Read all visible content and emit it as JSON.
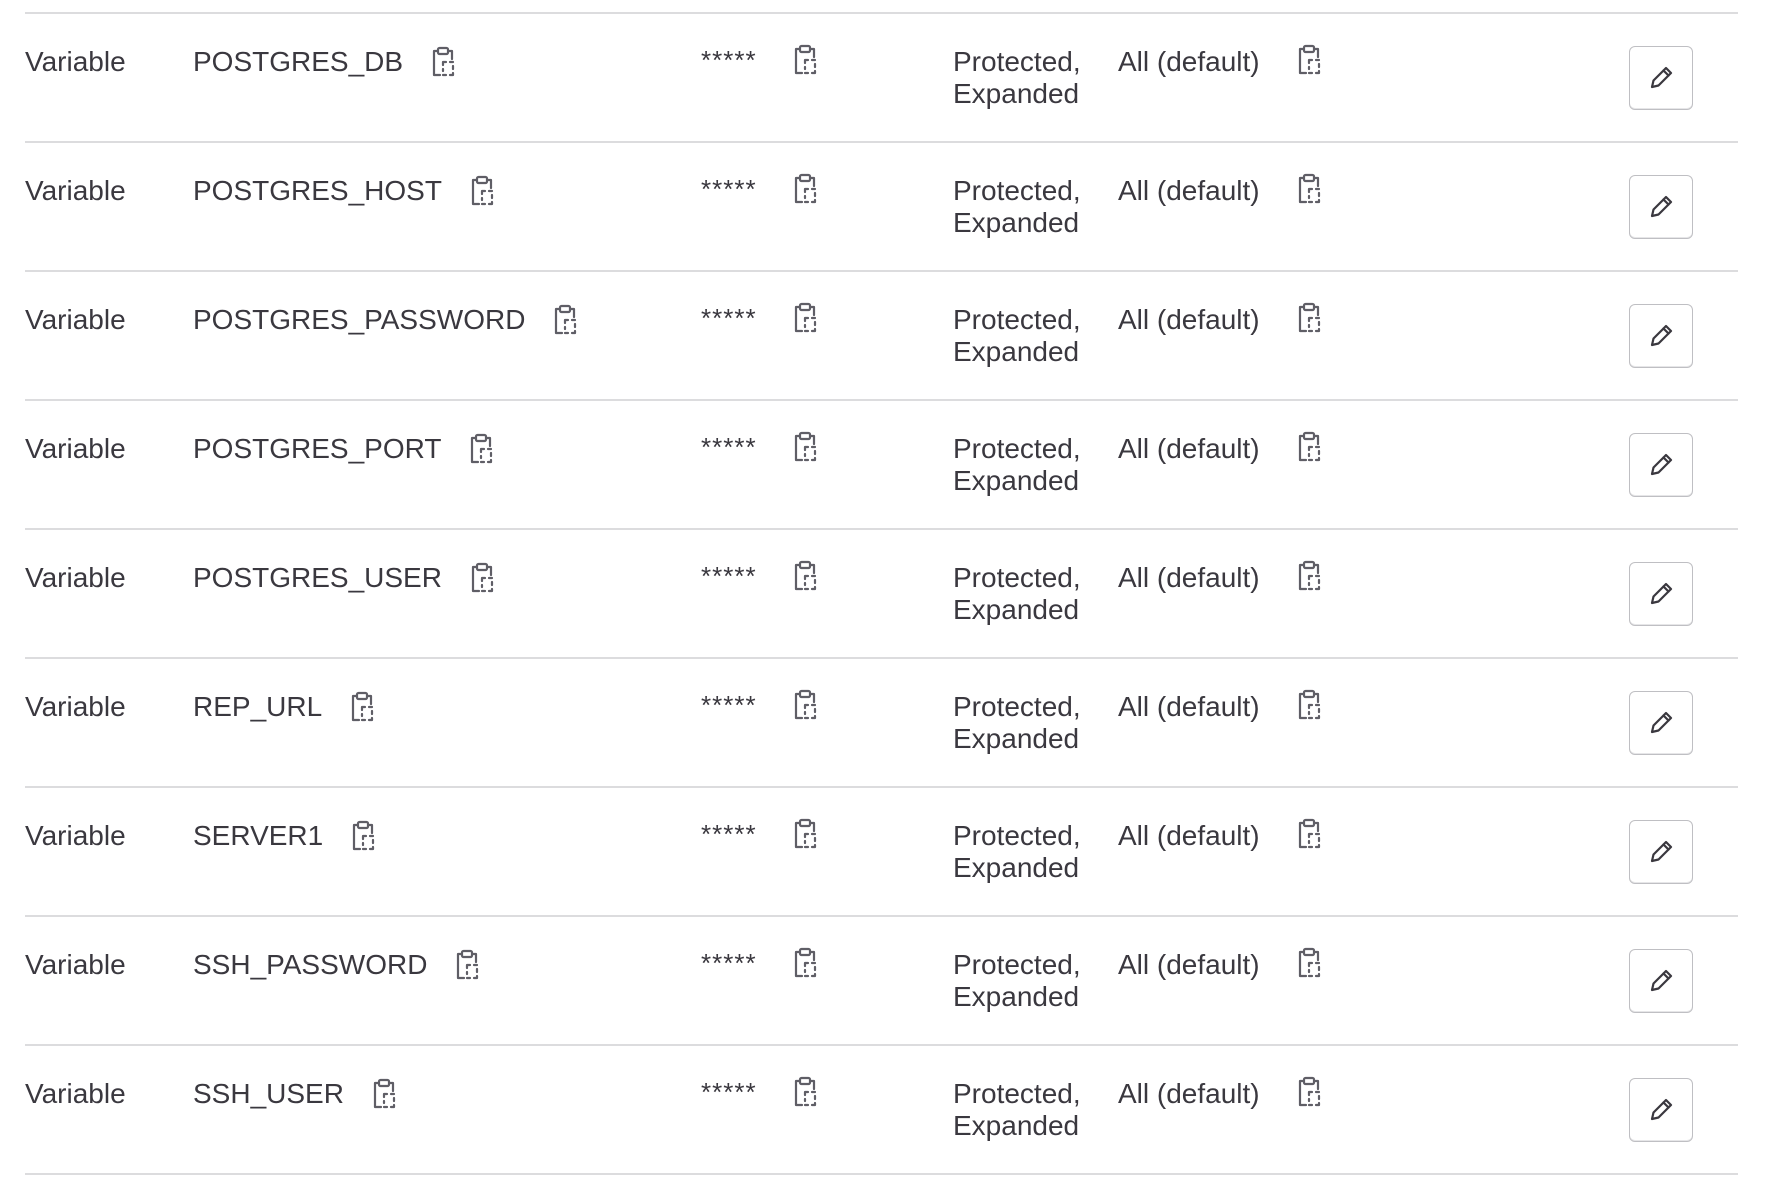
{
  "variables": [
    {
      "type": "Variable",
      "key": "POSTGRES_DB",
      "value": "*****",
      "attributes": [
        "Protected,",
        "Expanded"
      ],
      "environments": "All (default)"
    },
    {
      "type": "Variable",
      "key": "POSTGRES_HOST",
      "value": "*****",
      "attributes": [
        "Protected,",
        "Expanded"
      ],
      "environments": "All (default)"
    },
    {
      "type": "Variable",
      "key": "POSTGRES_PASSWORD",
      "value": "*****",
      "attributes": [
        "Protected,",
        "Expanded"
      ],
      "environments": "All (default)"
    },
    {
      "type": "Variable",
      "key": "POSTGRES_PORT",
      "value": "*****",
      "attributes": [
        "Protected,",
        "Expanded"
      ],
      "environments": "All (default)"
    },
    {
      "type": "Variable",
      "key": "POSTGRES_USER",
      "value": "*****",
      "attributes": [
        "Protected,",
        "Expanded"
      ],
      "environments": "All (default)"
    },
    {
      "type": "Variable",
      "key": "REP_URL",
      "value": "*****",
      "attributes": [
        "Protected,",
        "Expanded"
      ],
      "environments": "All (default)"
    },
    {
      "type": "Variable",
      "key": "SERVER1",
      "value": "*****",
      "attributes": [
        "Protected,",
        "Expanded"
      ],
      "environments": "All (default)"
    },
    {
      "type": "Variable",
      "key": "SSH_PASSWORD",
      "value": "*****",
      "attributes": [
        "Protected,",
        "Expanded"
      ],
      "environments": "All (default)"
    },
    {
      "type": "Variable",
      "key": "SSH_USER",
      "value": "*****",
      "attributes": [
        "Protected,",
        "Expanded"
      ],
      "environments": "All (default)"
    }
  ],
  "icons": {
    "copy": "copy-to-clipboard-icon",
    "edit": "pencil-icon"
  },
  "colors": {
    "text": "#3a383f",
    "divider": "#dcdcde",
    "icon": "#5f5e66",
    "button_border": "#bfbfc3"
  }
}
